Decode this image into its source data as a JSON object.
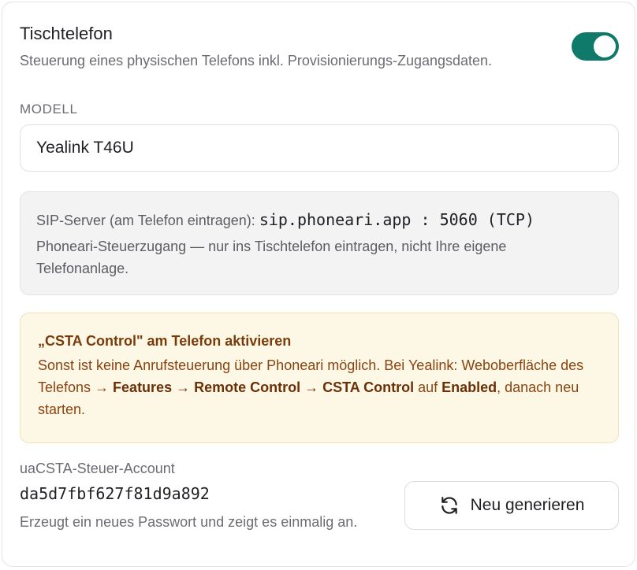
{
  "header": {
    "title": "Tischtelefon",
    "subtitle": "Steuerung eines physischen Telefons inkl. Provisionierungs-Zugangsdaten.",
    "toggle_on": true
  },
  "model": {
    "label": "MODELL",
    "value": "Yealink T46U"
  },
  "sip": {
    "label": "SIP-Server (am Telefon eintragen):",
    "server": "sip.phoneari.app : 5060 (TCP)",
    "description": "Phoneari-Steuerzugang — nur ins Tischtelefon eintragen, nicht Ihre eigene Telefonanlage."
  },
  "warning": {
    "title": "„CSTA Control\" am Telefon aktivieren",
    "text_1": "Sonst ist keine Anrufsteuerung über Phoneari möglich. Bei Yealink: Weboberfläche des Telefons → ",
    "path_1": "Features → Remote Control → CSTA Control",
    "text_2": " auf ",
    "enabled": "Enabled",
    "text_3": ", danach neu starten."
  },
  "account": {
    "label": "uaCSTA-Steuer-Account",
    "value": "da5d7fbf627f81d9a892",
    "hint": "Erzeugt ein neues Passwort und zeigt es einmalig an.",
    "regenerate_label": "Neu generieren"
  },
  "colors": {
    "toggle_on": "#0f7a6a",
    "warning_bg": "#fdf8e6",
    "warning_text": "#8a4310"
  }
}
